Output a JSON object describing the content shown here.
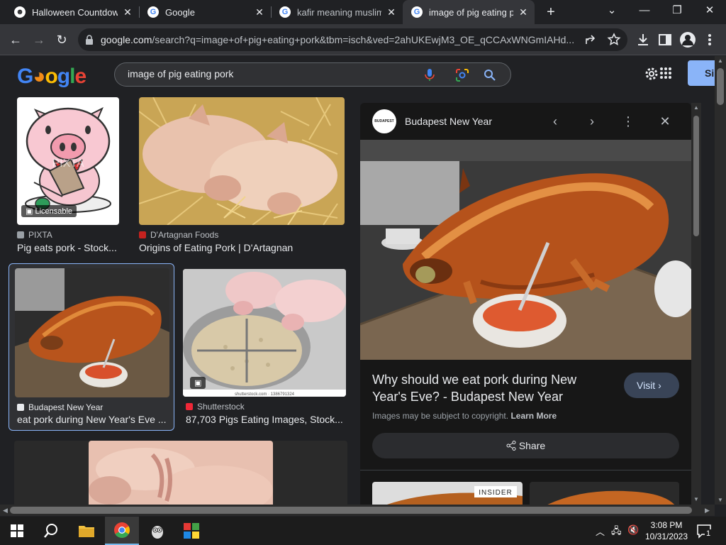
{
  "tabs": [
    {
      "title": "Halloween Countdown",
      "favicon": "pumpkin-favicon-icon"
    },
    {
      "title": "Google",
      "favicon": "google-g-icon"
    },
    {
      "title": "kafir meaning muslim -",
      "favicon": "google-g-icon"
    },
    {
      "title": "image of pig eating po",
      "favicon": "google-g-icon",
      "active": true
    }
  ],
  "new_tab": "+",
  "toolbar": {
    "url_host": "google.com",
    "url_rest": "/search?q=image+of+pig+eating+pork&tbm=isch&ved=2ahUKEwjM3_OE_qCCAxWNGmIAHd..."
  },
  "google": {
    "logo": "Google",
    "query": "image of pig eating pork",
    "signin_label": "Si"
  },
  "results": [
    {
      "source": "PIXTA",
      "caption": "Pig eats pork - Stock...",
      "badge": "Licensable",
      "watermark": "PIXTA",
      "source_color": "#9aa0a6"
    },
    {
      "source": "D'Artagnan Foods",
      "caption": "Origins of Eating Pork | D'Artagnan",
      "source_color": "#c5221f"
    },
    {
      "source": "Budapest New Year",
      "caption": "eat pork during New Year's Eve ...",
      "source_color": "#e8eaed"
    },
    {
      "source": "Shutterstock",
      "caption": "87,703 Pigs Eating Images, Stock...",
      "watermark": "shutterstock.com · 1386791324",
      "source_color": "#ee2737"
    }
  ],
  "preview": {
    "site_logo_text": "BUDAPEST",
    "site": "Budapest New Year",
    "title": "Why should we eat pork during New Year's Eve? - Budapest New Year",
    "visit_label": "Visit",
    "copyright_text": "Images may be subject to copyright.",
    "learn_more": "Learn More",
    "share_label": "Share",
    "related_label": "INSIDER"
  },
  "taskbar": {
    "time": "3:08 PM",
    "date": "10/31/2023",
    "notifications": "1"
  }
}
